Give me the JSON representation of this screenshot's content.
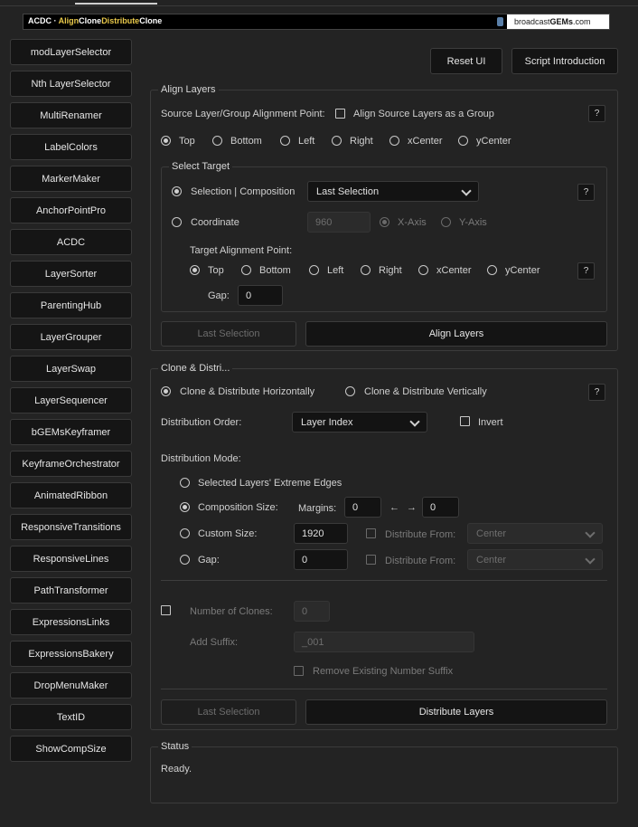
{
  "banner": {
    "title_prefix": "ACDC · ",
    "title_align": "Align",
    "title_clone": "Clone",
    "title_distribute": "Distribute",
    "title_clone2": "Clone",
    "logo_text_prefix": "broadcast",
    "logo_text_bold": "GEMs",
    "logo_text_suffix": ".com"
  },
  "sidebar": {
    "items": [
      "modLayerSelector",
      "Nth LayerSelector",
      "MultiRenamer",
      "LabelColors",
      "MarkerMaker",
      "AnchorPointPro",
      "ACDC",
      "LayerSorter",
      "ParentingHub",
      "LayerGrouper",
      "LayerSwap",
      "LayerSequencer",
      "bGEMsKeyframer",
      "KeyframeOrchestrator",
      "AnimatedRibbon",
      "ResponsiveTransitions",
      "ResponsiveLines",
      "PathTransformer",
      "ExpressionsLinks",
      "ExpressionsBakery",
      "DropMenuMaker",
      "TextID",
      "ShowCompSize"
    ]
  },
  "top": {
    "reset": "Reset UI",
    "intro": "Script Introduction"
  },
  "align": {
    "title": "Align Layers",
    "source_label": "Source Layer/Group Alignment Point:",
    "group_checkbox": "Align Source Layers as a Group",
    "help": "?",
    "points": [
      "Top",
      "Bottom",
      "Left",
      "Right",
      "xCenter",
      "yCenter"
    ],
    "select_target_title": "Select Target",
    "selection_label": "Selection | Composition",
    "selection_dropdown": "Last Selection",
    "coordinate_label": "Coordinate",
    "coordinate_value": "960",
    "x_axis": "X-Axis",
    "y_axis": "Y-Axis",
    "target_point_label": "Target Alignment Point:",
    "gap_label": "Gap:",
    "gap_value": "0",
    "last_selection_btn": "Last Selection",
    "align_btn": "Align Layers"
  },
  "clone": {
    "title": "Clone & Distri...",
    "horizontal": "Clone & Distribute Horizontally",
    "vertical": "Clone & Distribute Vertically",
    "order_label": "Distribution Order:",
    "order_value": "Layer Index",
    "invert": "Invert",
    "mode_label": "Distribution Mode:",
    "mode_edges": "Selected Layers' Extreme Edges",
    "mode_comp": "Composition Size:",
    "margins_label": "Margins:",
    "margin_left": "0",
    "margin_right": "0",
    "arrow_left": "←",
    "arrow_right": "→",
    "mode_custom": "Custom Size:",
    "custom_value": "1920",
    "distribute_from": "Distribute From:",
    "center": "Center",
    "mode_gap": "Gap:",
    "gap_value": "0",
    "num_clones_label": "Number of Clones:",
    "num_clones_value": "0",
    "suffix_label": "Add Suffix:",
    "suffix_value": "_001",
    "remove_suffix": "Remove Existing Number Suffix",
    "last_selection_btn": "Last Selection",
    "distribute_btn": "Distribute Layers"
  },
  "status": {
    "title": "Status",
    "text": "Ready."
  }
}
